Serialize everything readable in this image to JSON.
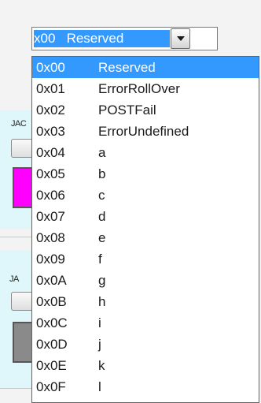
{
  "combobox": {
    "selected_text": "x00   Reserved",
    "dropdown_icon": "chevron-down-icon"
  },
  "background": {
    "label_1": "JAC",
    "label_2": "JA",
    "swatch_1_color": "#ff00ff",
    "swatch_2_color": "#8a8a8a"
  },
  "list": {
    "selected_index": 0,
    "items": [
      {
        "code": "0x00",
        "name": "Reserved"
      },
      {
        "code": "0x01",
        "name": "ErrorRollOver"
      },
      {
        "code": "0x02",
        "name": "POSTFail"
      },
      {
        "code": "0x03",
        "name": "ErrorUndefined"
      },
      {
        "code": "0x04",
        "name": "a"
      },
      {
        "code": "0x05",
        "name": "b"
      },
      {
        "code": "0x06",
        "name": "c"
      },
      {
        "code": "0x07",
        "name": "d"
      },
      {
        "code": "0x08",
        "name": "e"
      },
      {
        "code": "0x09",
        "name": "f"
      },
      {
        "code": "0x0A",
        "name": "g"
      },
      {
        "code": "0x0B",
        "name": "h"
      },
      {
        "code": "0x0C",
        "name": "i"
      },
      {
        "code": "0x0D",
        "name": "j"
      },
      {
        "code": "0x0E",
        "name": "k"
      },
      {
        "code": "0x0F",
        "name": "l"
      }
    ]
  },
  "colors": {
    "selection": "#3399ff",
    "panel_bg": "#dff7fb"
  }
}
